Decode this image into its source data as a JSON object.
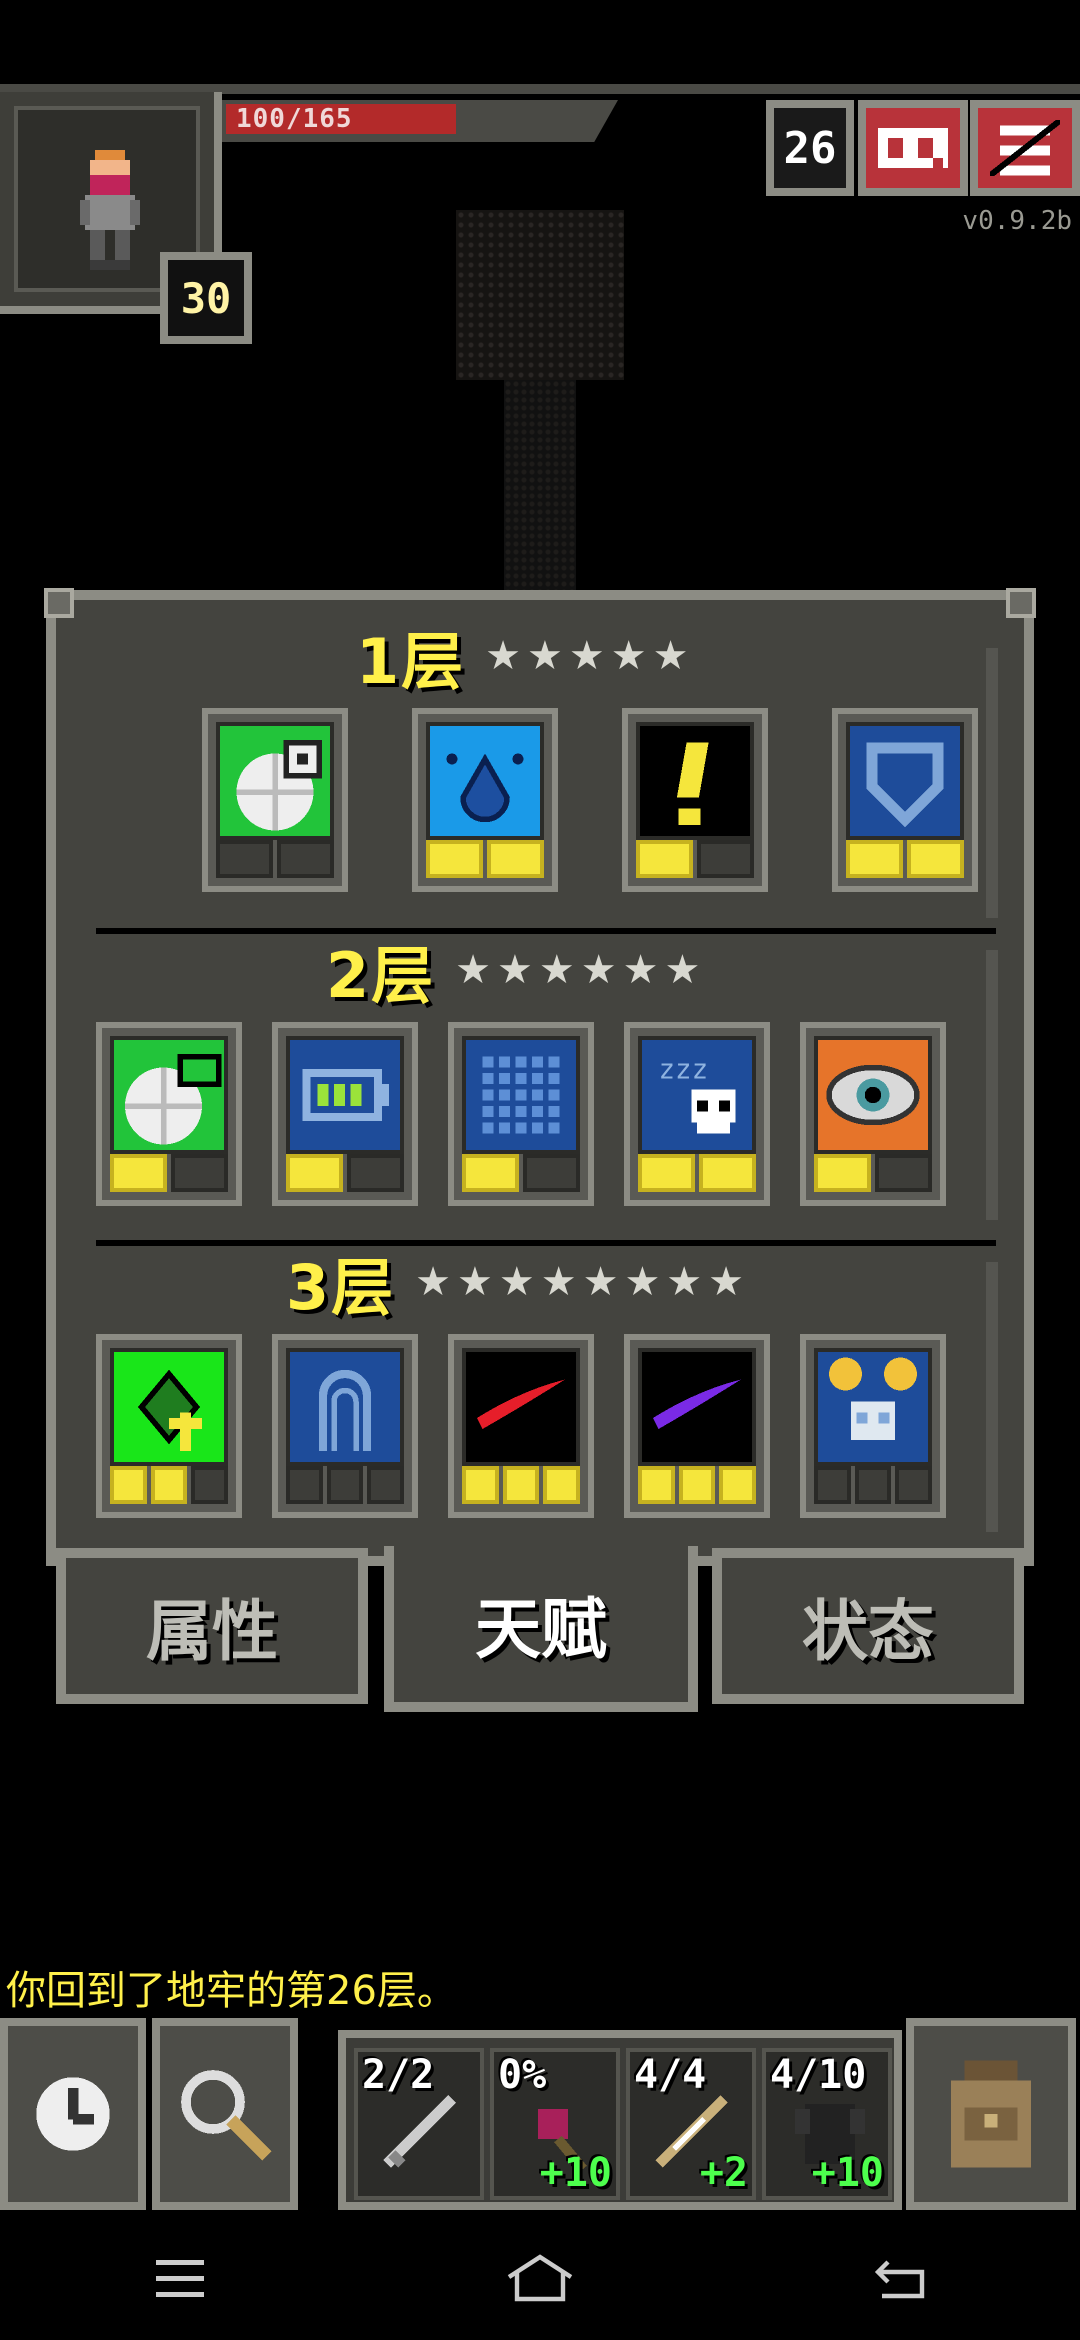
{
  "hud": {
    "hp_text": "100/165",
    "hp_fraction": 0.606,
    "hero_level": "30",
    "depth": "26",
    "version": "v0.9.2b",
    "journal_icon": "journal-icon",
    "menu_icon": "menu-icon"
  },
  "talents": {
    "tiers": [
      {
        "title": "1层",
        "stars": "★★★★★",
        "slots": [
          {
            "icon": "hearty-meal-icon",
            "color": "#22c43a",
            "points": [
              false,
              false
            ]
          },
          {
            "icon": "water-drop-icon",
            "color": "#1a9ae8",
            "points": [
              true,
              true
            ]
          },
          {
            "icon": "exclamation-icon",
            "color": "#000000",
            "points": [
              true,
              false
            ]
          },
          {
            "icon": "shield-icon",
            "color": "#1e4c9a",
            "points": [
              true,
              true
            ]
          }
        ]
      },
      {
        "title": "2层",
        "stars": "★★★★★★",
        "slots": [
          {
            "icon": "energy-meal-icon",
            "color": "#22c43a",
            "points": [
              true,
              false
            ]
          },
          {
            "icon": "battery-icon",
            "color": "#1e4c9a",
            "points": [
              true,
              false
            ]
          },
          {
            "icon": "grid-icon",
            "color": "#1e4c9a",
            "points": [
              true,
              false
            ]
          },
          {
            "icon": "sleep-skull-icon",
            "color": "#1e4c9a",
            "points": [
              true,
              true
            ]
          },
          {
            "icon": "eye-icon",
            "color": "#e6742a",
            "points": [
              true,
              false
            ]
          }
        ]
      },
      {
        "title": "3层",
        "stars": "★★★★★★★★",
        "slots": [
          {
            "icon": "leaf-arrow-icon",
            "color": "#19e619",
            "points": [
              true,
              true,
              false
            ]
          },
          {
            "icon": "ghost-outline-icon",
            "color": "#1e4c9a",
            "points": [
              false,
              false,
              false
            ]
          },
          {
            "icon": "red-slash-icon",
            "color": "#000000",
            "points": [
              true,
              true,
              true
            ]
          },
          {
            "icon": "purple-slash-icon",
            "color": "#000000",
            "points": [
              true,
              true,
              true
            ]
          },
          {
            "icon": "skull-coins-icon",
            "color": "#1e4c9a",
            "points": [
              false,
              false,
              false
            ]
          }
        ]
      }
    ]
  },
  "tabs": {
    "stats": "属性",
    "talents": "天赋",
    "buffs": "状态"
  },
  "log": "你回到了地牢的第26层。",
  "toolbar": {
    "wait_icon": "clock-icon",
    "search_icon": "magnifier-icon",
    "backpack_icon": "backpack-icon",
    "quickslots": [
      {
        "icon": "sword-icon",
        "top": "2/2",
        "bottom": ""
      },
      {
        "icon": "flail-icon",
        "top": "0%",
        "bottom": "+10"
      },
      {
        "icon": "wand-icon",
        "top": "4/4",
        "bottom": "+2"
      },
      {
        "icon": "armor-icon",
        "top": "4/10",
        "bottom": "+10"
      }
    ]
  },
  "navbar": {
    "menu": "menu-lines-icon",
    "home": "home-icon",
    "back": "back-icon"
  }
}
